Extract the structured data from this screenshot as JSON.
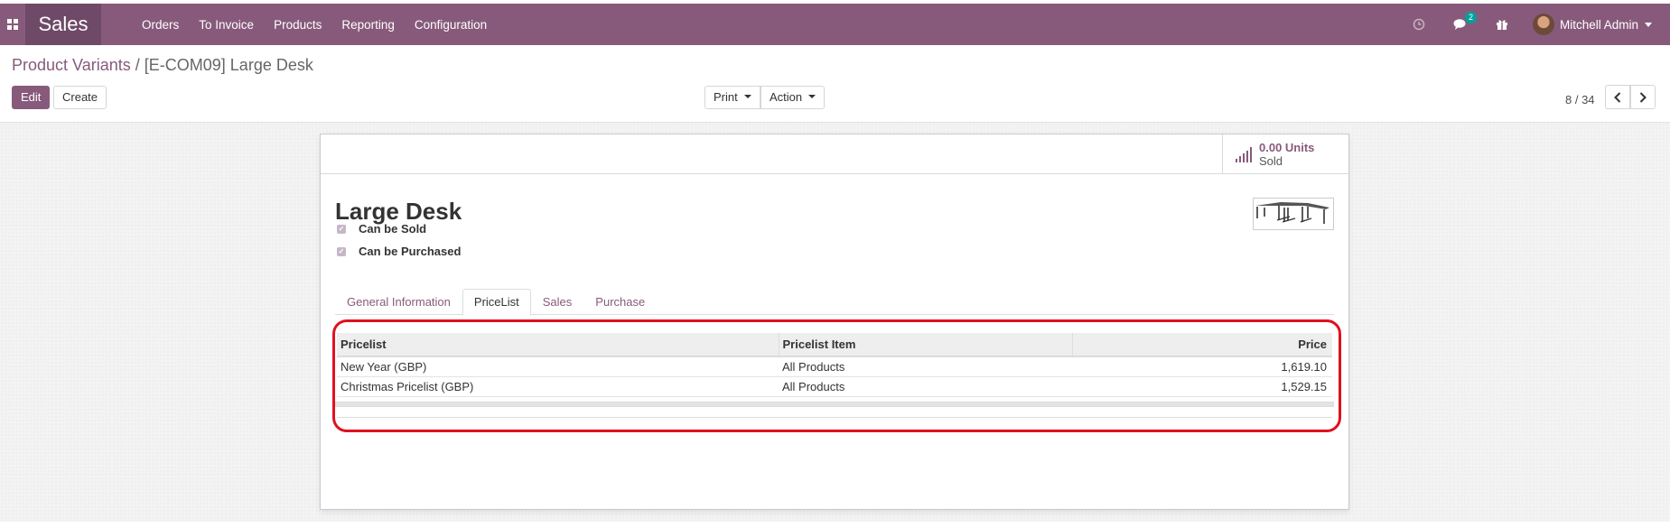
{
  "navbar": {
    "app_name": "Sales",
    "menu": [
      "Orders",
      "To Invoice",
      "Products",
      "Reporting",
      "Configuration"
    ],
    "message_badge": "2",
    "user_name": "Mitchell Admin",
    "icons": [
      "apps-icon",
      "clock-icon",
      "chat-icon",
      "gift-icon"
    ]
  },
  "breadcrumb": {
    "parent": "Product Variants",
    "separator": "/",
    "current": "[E-COM09] Large Desk"
  },
  "actions": {
    "edit": "Edit",
    "create": "Create",
    "print": "Print",
    "action": "Action"
  },
  "pager": {
    "value": "8 / 34"
  },
  "stat_button": {
    "value": "0.00 Units",
    "label": "Sold"
  },
  "product": {
    "name": "Large Desk",
    "can_be_sold": "Can be Sold",
    "can_be_purchased": "Can be Purchased"
  },
  "tabs": [
    "General Information",
    "PriceList",
    "Sales",
    "Purchase"
  ],
  "active_tab": "PriceList",
  "pricelist_table": {
    "headers": [
      "Pricelist",
      "Pricelist Item",
      "Price"
    ],
    "rows": [
      [
        "New Year (GBP)",
        "All Products",
        "1,619.10"
      ],
      [
        "Christmas Pricelist (GBP)",
        "All Products",
        "1,529.15"
      ]
    ]
  },
  "colors": {
    "brand": "#875a7b",
    "brand_dark": "#6f4a68",
    "highlight": "#e0101f",
    "badge": "#00a09d"
  }
}
